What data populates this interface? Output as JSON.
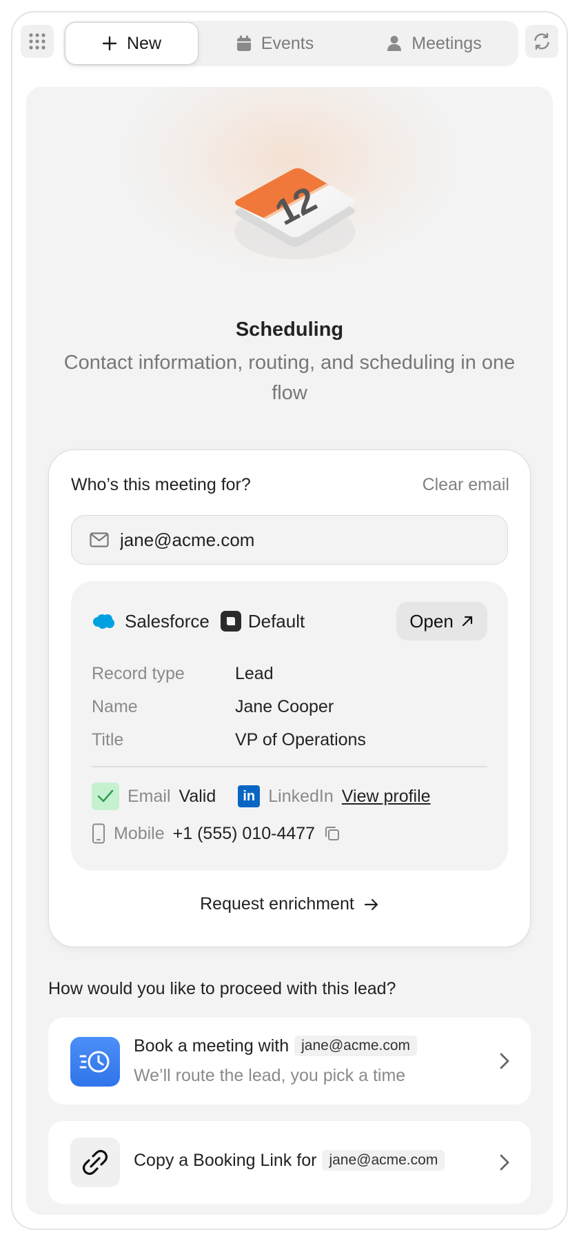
{
  "nav": {
    "new_label": "New",
    "events_label": "Events",
    "meetings_label": "Meetings"
  },
  "hero": {
    "calendar_day": "12",
    "title": "Scheduling",
    "subtitle": "Contact information, routing, and scheduling in one flow"
  },
  "lead_card": {
    "question": "Who’s this meeting for?",
    "clear_label": "Clear email",
    "email_value": "jane@acme.com",
    "record": {
      "source": "Salesforce",
      "profile": "Default",
      "open_label": "Open",
      "fields": [
        {
          "label": "Record type",
          "value": "Lead"
        },
        {
          "label": "Name",
          "value": "Jane Cooper"
        },
        {
          "label": "Title",
          "value": "VP of Operations"
        }
      ],
      "email_label": "Email",
      "email_status": "Valid",
      "linkedin_label": "LinkedIn",
      "linkedin_link": "View profile",
      "mobile_label": "Mobile",
      "mobile_value": "+1 (555) 010-4477"
    },
    "enrich_label": "Request enrichment"
  },
  "proceed": {
    "question": "How would you like to proceed with this lead?",
    "options": [
      {
        "title": "Book a meeting with",
        "pill": "jane@acme.com",
        "subtitle": "We’ll route the lead, you pick a time",
        "icon": "clock-routing-icon"
      },
      {
        "title": "Copy a Booking Link for",
        "pill": "jane@acme.com",
        "icon": "link-icon"
      }
    ]
  },
  "colors": {
    "accent_orange": "#f0783a",
    "accent_blue": "#3a7ff0",
    "valid_green": "#c6f1d0",
    "linkedin_blue": "#0a66c2",
    "salesforce_blue": "#00a1e0"
  }
}
